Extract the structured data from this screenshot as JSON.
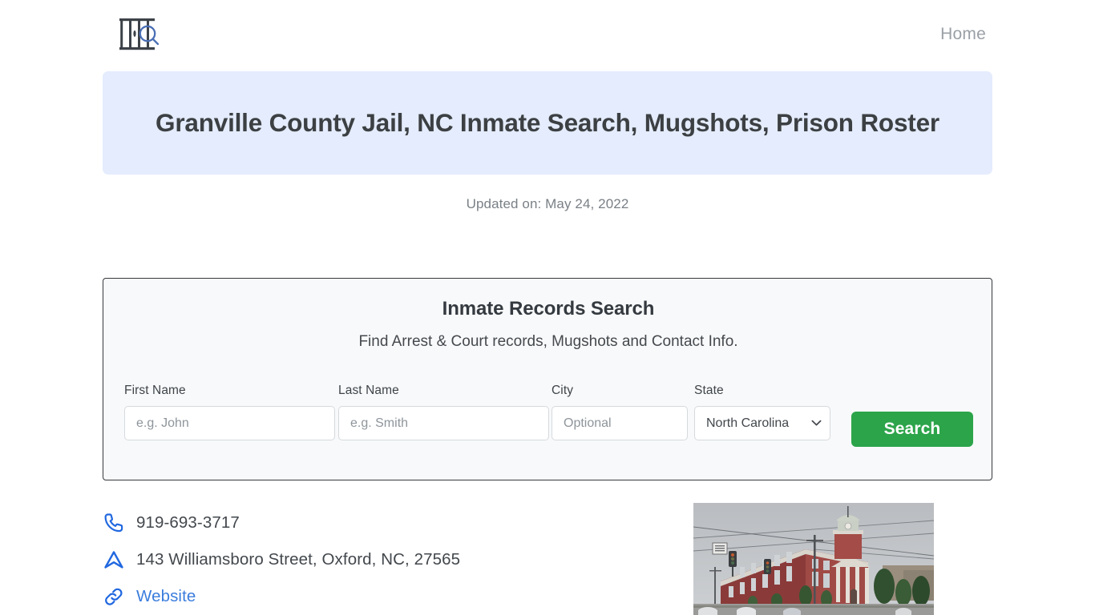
{
  "header": {
    "logo_name": "jail-bars-search-logo",
    "nav": [
      {
        "label": "Home"
      }
    ]
  },
  "hero": {
    "title": "Granville County Jail, NC Inmate Search, Mugshots, Prison Roster",
    "background_color": "#e4ecfd"
  },
  "updated": {
    "text": "Updated on: May 24, 2022"
  },
  "search_card": {
    "title": "Inmate Records Search",
    "subtitle": "Find Arrest & Court records, Mugshots and Contact Info.",
    "fields": {
      "first_name": {
        "label": "First Name",
        "value": "",
        "placeholder": "e.g. John"
      },
      "last_name": {
        "label": "Last Name",
        "value": "",
        "placeholder": "e.g. Smith"
      },
      "city": {
        "label": "City",
        "value": "",
        "placeholder": "Optional"
      },
      "state": {
        "label": "State",
        "selected": "North Carolina"
      }
    },
    "submit_label": "Search",
    "submit_color": "#2ca44a"
  },
  "contact": {
    "phone": {
      "icon": "phone-icon",
      "text": "919-693-3717"
    },
    "address": {
      "icon": "navigation-arrow-icon",
      "text": "143 Williamsboro Street, Oxford, NC, 27565"
    },
    "website": {
      "icon": "link-icon",
      "text": "Website",
      "color": "#3b7ddd"
    }
  },
  "facility_photo": {
    "alt": "Granville County courthouse red brick building with cupola"
  }
}
